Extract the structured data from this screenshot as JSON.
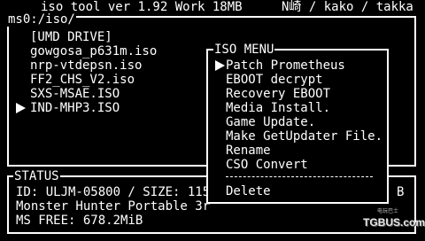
{
  "titlebar": {
    "app": "iso_tool ver 1.92 Work 18MB",
    "credits": "N崎 / kako / takka"
  },
  "browser": {
    "path": "ms0:/iso/",
    "items": [
      "[UMD DRIVE]",
      "gowgosa_p631m.iso",
      "nrp-vtdepsn.iso",
      "FF2_CHS_V2.iso",
      "SXS-MSAE.ISO",
      "IND-MHP3.ISO"
    ],
    "selected_index": 5
  },
  "status": {
    "title": "STATUS",
    "line1": "ID: ULJM-05800 / SIZE: 115",
    "line1_right": "B",
    "line2": "Monster Hunter Portable 3r",
    "line3": "MS FREE: 678.2MiB"
  },
  "menu": {
    "title": "ISO MENU",
    "items": [
      "Patch Prometheus",
      "EBOOT decrypt",
      "Recovery EBOOT",
      "Media Install.",
      "Game Update.",
      "Make GetUpdater File.",
      "Rename",
      "CSO Convert",
      "Delete"
    ],
    "selected_index": 0
  },
  "watermark": {
    "text": "TGBUS.com",
    "sub": "电玩巴士"
  }
}
